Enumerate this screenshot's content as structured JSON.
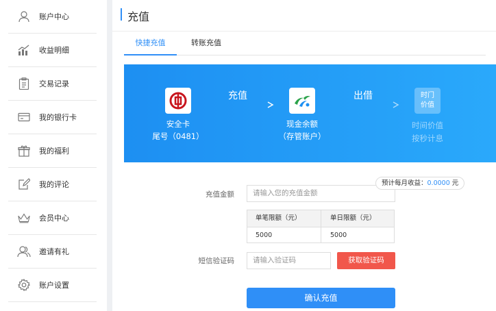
{
  "sidebar": {
    "items": [
      {
        "label": "账户中心",
        "icon": "user-icon"
      },
      {
        "label": "收益明细",
        "icon": "bar-chart-icon"
      },
      {
        "label": "交易记录",
        "icon": "clipboard-icon"
      },
      {
        "label": "我的银行卡",
        "icon": "credit-card-icon"
      },
      {
        "label": "我的福利",
        "icon": "gift-icon"
      },
      {
        "label": "我的评论",
        "icon": "edit-icon"
      },
      {
        "label": "会员中心",
        "icon": "crown-icon"
      },
      {
        "label": "邀请有礼",
        "icon": "users-icon"
      },
      {
        "label": "账户设置",
        "icon": "gear-icon"
      }
    ]
  },
  "page": {
    "title": "充值"
  },
  "tabs": [
    {
      "label": "快捷充值",
      "active": true
    },
    {
      "label": "转账充值",
      "active": false
    }
  ],
  "flow": {
    "card_label": "安全卡",
    "card_tail": "尾号（0481）",
    "step1_label": "充值",
    "balance_label": "现金余额",
    "balance_sub": "（存管账户）",
    "step2_label": "出借",
    "product_icon_line1": "时门",
    "product_icon_line2": "价值",
    "product_label": "时间价值",
    "product_sub": "按秒计息"
  },
  "form": {
    "amount_label": "充值金额",
    "amount_placeholder": "请输入您的充值金额",
    "tip_prefix": "预计每月收益：",
    "tip_value": "0.0000",
    "tip_unit": " 元",
    "limit_headers": [
      "单笔限额（元）",
      "单日限额（元）"
    ],
    "limit_values": [
      "5000",
      "5000"
    ],
    "sms_label": "短信验证码",
    "sms_placeholder": "请输入验证码",
    "get_code_label": "获取验证码",
    "confirm_label": "确认充值"
  },
  "colors": {
    "accent": "#2f8ff7",
    "danger": "#f1574b",
    "bank_red": "#c8151d"
  }
}
